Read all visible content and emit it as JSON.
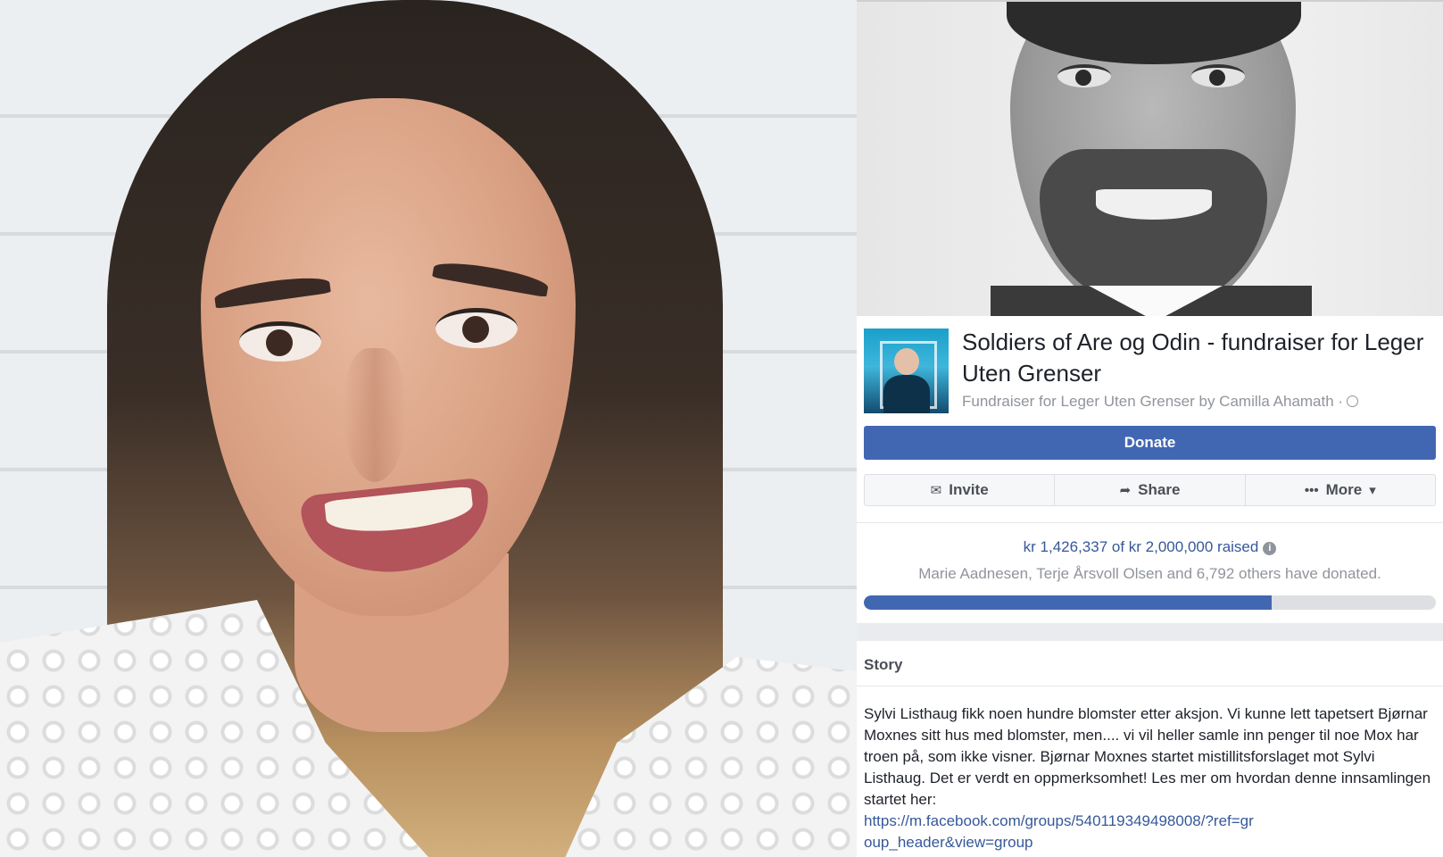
{
  "fundraiser": {
    "title": "Soldiers of Are og Odin - fundraiser for Leger Uten Grenser",
    "subtitle": "Fundraiser for Leger Uten Grenser by Camilla Ahamath ·",
    "privacy_icon": "globe-icon"
  },
  "actions": {
    "donate_label": "Donate",
    "invite_label": "Invite",
    "share_label": "Share",
    "more_label": "More"
  },
  "icons": {
    "invite": "envelope-icon",
    "share": "share-arrow-icon",
    "more": "ellipsis-icon",
    "more_caret": "caret-down-icon",
    "info": "info-icon"
  },
  "progress": {
    "raised_text": "kr 1,426,337 of kr 2,000,000 raised",
    "donors_text": "Marie Aadnesen, Terje Årsvoll Olsen and 6,792 others have donated.",
    "fraction": 0.713
  },
  "story": {
    "heading": "Story",
    "body": "Sylvi Listhaug fikk noen hundre blomster etter aksjon. Vi kunne lett tapetsert Bjørnar Moxnes sitt hus med blomster, men.... vi vil heller samle inn penger til noe Mox har troen på, som ikke visner. Bjørnar Moxnes startet mistillitsforslaget mot Sylvi Listhaug. Det er verdt en oppmerksomhet! Les mer om hvordan denne innsamlingen startet her:",
    "link": "https://m.facebook.com/groups/540119349498008/?ref=group_header&view=group"
  },
  "colors": {
    "brand_blue": "#4267b2",
    "link_blue": "#365899",
    "muted_gray": "#90949c"
  }
}
